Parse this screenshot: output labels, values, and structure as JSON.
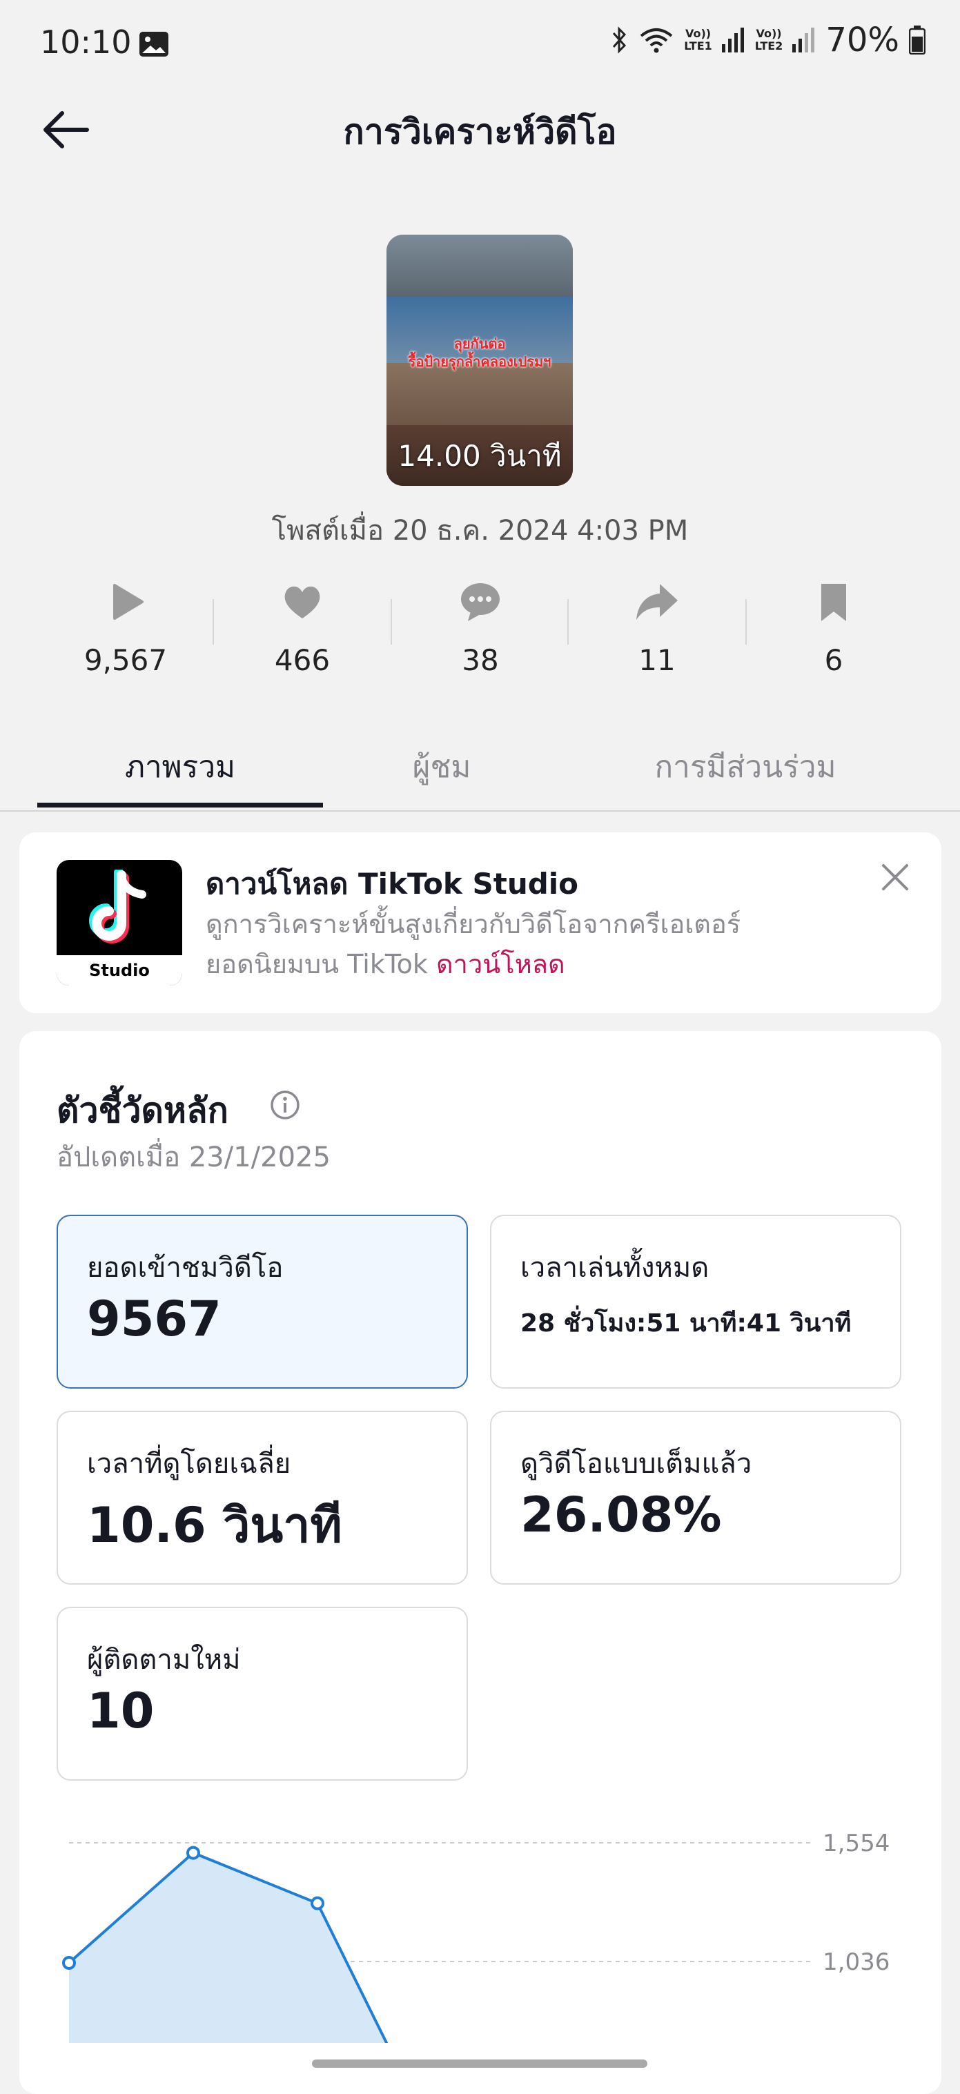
{
  "status_bar": {
    "time": "10:10",
    "sim1": "Vo))\nLTE1",
    "sim2": "Vo))\nLTE2",
    "battery": "70%"
  },
  "header": {
    "title": "การวิเคราะห์วิดีโอ"
  },
  "video": {
    "duration": "14.00 วินาที",
    "caption_line1": "ลุยกันต่อ",
    "caption_line2": "รื้อป้ายรุกล้ำคลองเปรมฯ",
    "posted": "โพสต์เมื่อ 20 ธ.ค. 2024 4:03 PM"
  },
  "stats": {
    "plays": "9,567",
    "likes": "466",
    "comments": "38",
    "shares": "11",
    "saves": "6"
  },
  "tabs": [
    {
      "label": "ภาพรวม"
    },
    {
      "label": "ผู้ชม"
    },
    {
      "label": "การมีส่วนร่วม"
    }
  ],
  "promo": {
    "logo_text": "Studio",
    "title": "ดาวน์โหลด TikTok Studio",
    "desc_line1": "ดูการวิเคราะห์ขั้นสูงเกี่ยวกับวิดีโอจากครีเอเตอร์",
    "desc_line2": "ยอดนิยมบน TikTok",
    "link": "ดาวน์โหลด"
  },
  "metrics": {
    "title": "ตัวชี้วัดหลัก",
    "updated": "อัปเดตเมื่อ 23/1/2025",
    "items": [
      {
        "label": "ยอดเข้าชมวิดีโอ",
        "value": "9567"
      },
      {
        "label": "เวลาเล่นทั้งหมด",
        "value": "28 ชั่วโมง:51 นาที:41 วินาที"
      },
      {
        "label": "เวลาที่ดูโดยเฉลี่ย",
        "value": "10.6 วินาที"
      },
      {
        "label": "ดูวิดีโอแบบเต็มแล้ว",
        "value": "26.08%"
      },
      {
        "label": "ผู้ติดตามใหม่",
        "value": "10"
      }
    ]
  },
  "chart_data": {
    "type": "area",
    "title": "",
    "xlabel": "",
    "ylabel": "",
    "y_ticks": [
      "1,554",
      "1,036"
    ],
    "y_tick_values": [
      1554,
      1036
    ],
    "x": [
      0,
      1,
      2
    ],
    "values": [
      1030,
      1510,
      1290
    ],
    "series_color": "#1f7fd6",
    "fill_color": "#d6e7f8"
  },
  "colors": {
    "accent": "#c21559",
    "selected_border": "#3a73b5"
  }
}
